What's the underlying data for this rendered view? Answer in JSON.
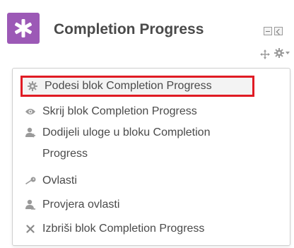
{
  "block": {
    "title": "Completion Progress",
    "icon": "asterisk-icon",
    "icon_color": "#9c59b6"
  },
  "header_controls": {
    "minimize_icon": "minimize-icon",
    "dock_icon": "dock-icon",
    "move_icon": "move-icon",
    "actions_icon": "gear-icon"
  },
  "menu": {
    "highlight_color": "#e01b24",
    "items": [
      {
        "label": "Podesi blok Completion Progress",
        "icon": "gear-icon",
        "highlighted": true
      },
      {
        "label": "Skrij blok Completion Progress",
        "icon": "eye-icon"
      },
      {
        "label": "Dodijeli uloge u bloku Completion Progress",
        "icon": "user-assign-icon"
      },
      {
        "label": "Ovlasti",
        "icon": "key-icon"
      },
      {
        "label": "Provjera ovlasti",
        "icon": "user-check-icon"
      },
      {
        "label": "Izbriši blok Completion Progress",
        "icon": "delete-icon"
      }
    ]
  }
}
